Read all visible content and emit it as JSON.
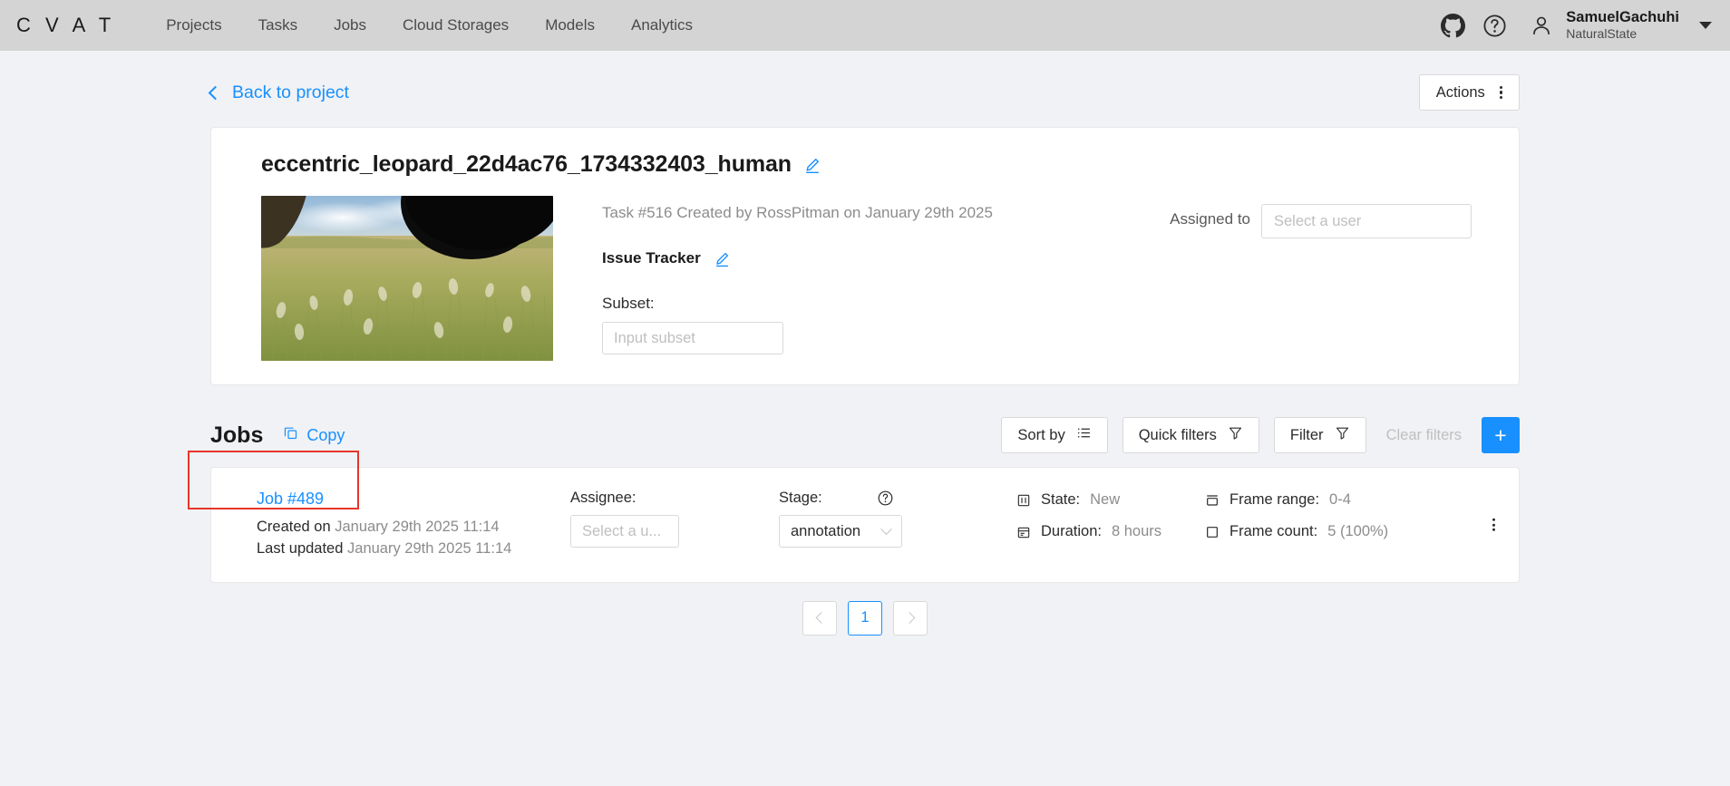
{
  "navbar": {
    "logo": "C V A T",
    "links": [
      {
        "label": "Projects"
      },
      {
        "label": "Tasks"
      },
      {
        "label": "Jobs"
      },
      {
        "label": "Cloud Storages"
      },
      {
        "label": "Models"
      },
      {
        "label": "Analytics"
      }
    ],
    "github_icon": "github-icon",
    "help_icon": "question-circle-icon",
    "user": {
      "name": "SamuelGachuhi",
      "organization": "NaturalState"
    }
  },
  "topbar": {
    "back_label": "Back to project",
    "actions_label": "Actions"
  },
  "task": {
    "title": "eccentric_leopard_22d4ac76_1734332403_human",
    "meta": "Task #516 Created by RossPitman on January 29th 2025",
    "issue_tracker_label": "Issue Tracker",
    "subset_label": "Subset:",
    "subset_placeholder": "Input subset",
    "subset_value": "",
    "assigned_to_label": "Assigned to",
    "assignee_placeholder": "Select a user"
  },
  "jobs_section": {
    "title": "Jobs",
    "copy_label": "Copy",
    "sort_by_label": "Sort by",
    "quick_filters_label": "Quick filters",
    "filter_label": "Filter",
    "clear_filters_label": "Clear filters",
    "add_label": "+"
  },
  "jobs": [
    {
      "id_label": "Job #489",
      "created_label": "Created on",
      "created_value": "January 29th 2025 11:14",
      "updated_label": "Last updated",
      "updated_value": "January 29th 2025 11:14",
      "assignee_label": "Assignee:",
      "assignee_placeholder": "Select a u...",
      "stage_label": "Stage:",
      "stage_value": "annotation",
      "state_label": "State:",
      "state_value": "New",
      "duration_label": "Duration:",
      "duration_value": "8 hours",
      "frame_range_label": "Frame range:",
      "frame_range_value": "0-4",
      "frame_count_label": "Frame count:",
      "frame_count_value": "5 (100%)"
    }
  ],
  "pagination": {
    "prev": "‹",
    "current": "1",
    "next": "›"
  },
  "colors": {
    "accent": "#1890ff",
    "navbar_bg": "#d4d4d4",
    "page_bg": "#f0f2f5",
    "highlight": "#e8352b",
    "muted_text": "#8c8c8c"
  }
}
